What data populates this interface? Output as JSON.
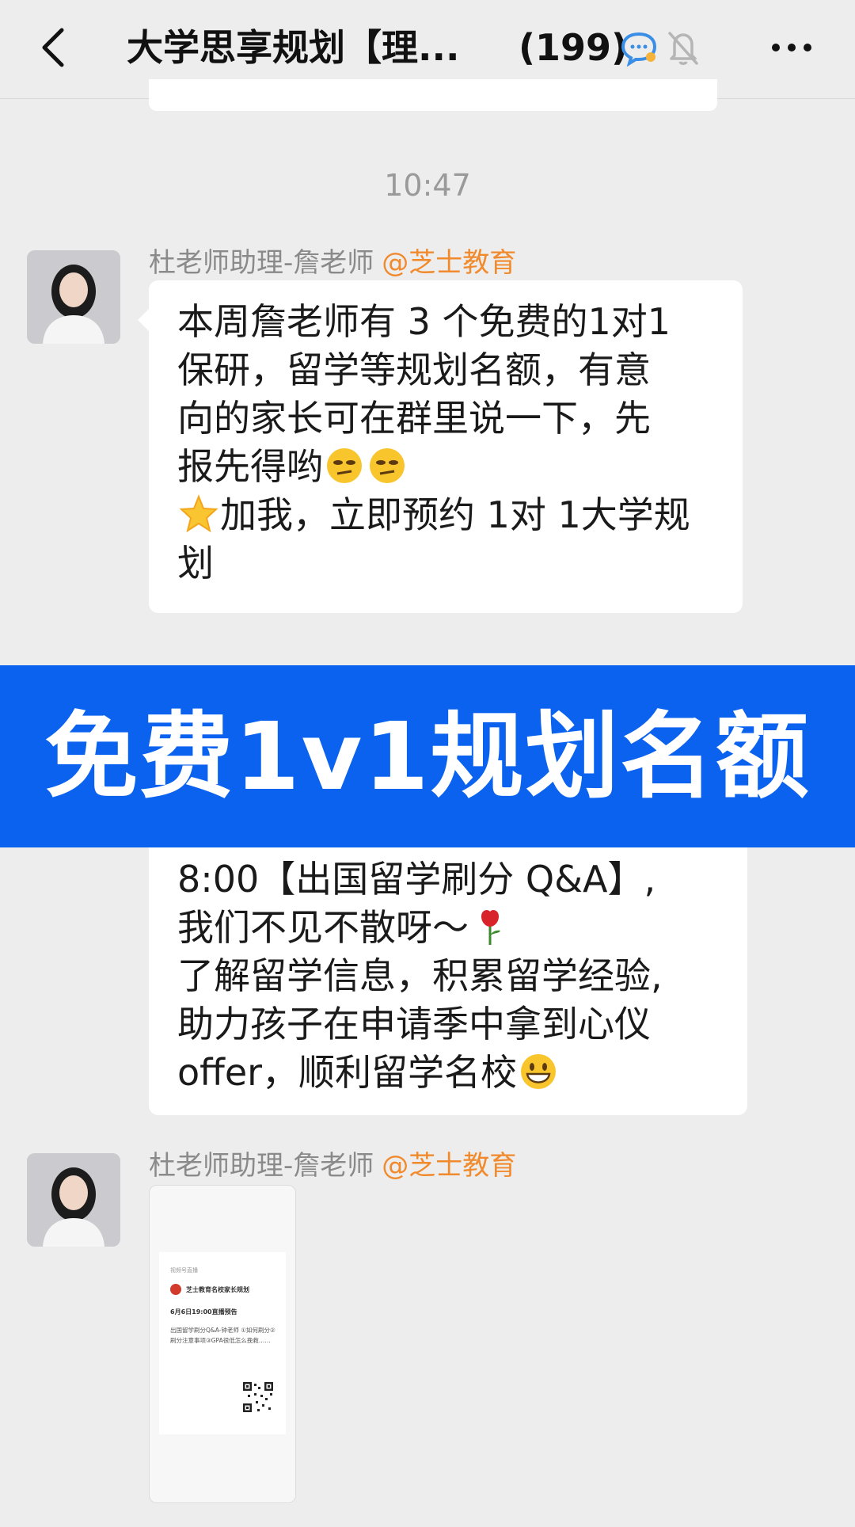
{
  "header": {
    "title": "大学思享规划【理...",
    "count": "(199)",
    "icons": [
      "back-arrow-icon",
      "group-chat-icon",
      "mute-bell-icon",
      "more-icon"
    ]
  },
  "time": "10:47",
  "messages": [
    {
      "sender": "杜老师助理-詹老师",
      "org": "@芝士教育",
      "lines": [
        "本周詹老师有 3 个免费的1对1",
        "保研，留学等规划名额，有意",
        "向的家长可在群里说一下，先",
        "报先得哟",
        "加我，立即预约 1对 1大学规",
        "划"
      ],
      "emojis": [
        "thinking-face-icon",
        "star-icon"
      ]
    },
    {
      "lines": [
        "8:00【出国留学刷分 Q&A】,",
        "我们不见不散呀～",
        "了解留学信息，积累留学经验,",
        "助力孩子在申请季中拿到心仪",
        "offer，顺利留学名校"
      ],
      "emojis": [
        "rose-icon",
        "grinning-face-icon"
      ]
    },
    {
      "sender": "杜老师助理-詹老师",
      "org": "@芝士教育",
      "poster": {
        "top": "视频号直播",
        "name": "芝士教育名校家长规划",
        "date": "6月6日19:00直播预告",
        "body": "出国留学刷分Q&A-钟老师 ①如何刷分②刷分注意事项③GPA很低怎么挽救……"
      }
    }
  ],
  "banner": "免费1v1规划名额",
  "colors": {
    "background": "#ededed",
    "bubble": "#ffffff",
    "banner": "#0a62ef",
    "org": "#f08a2c",
    "meta": "#8a8a8a"
  }
}
